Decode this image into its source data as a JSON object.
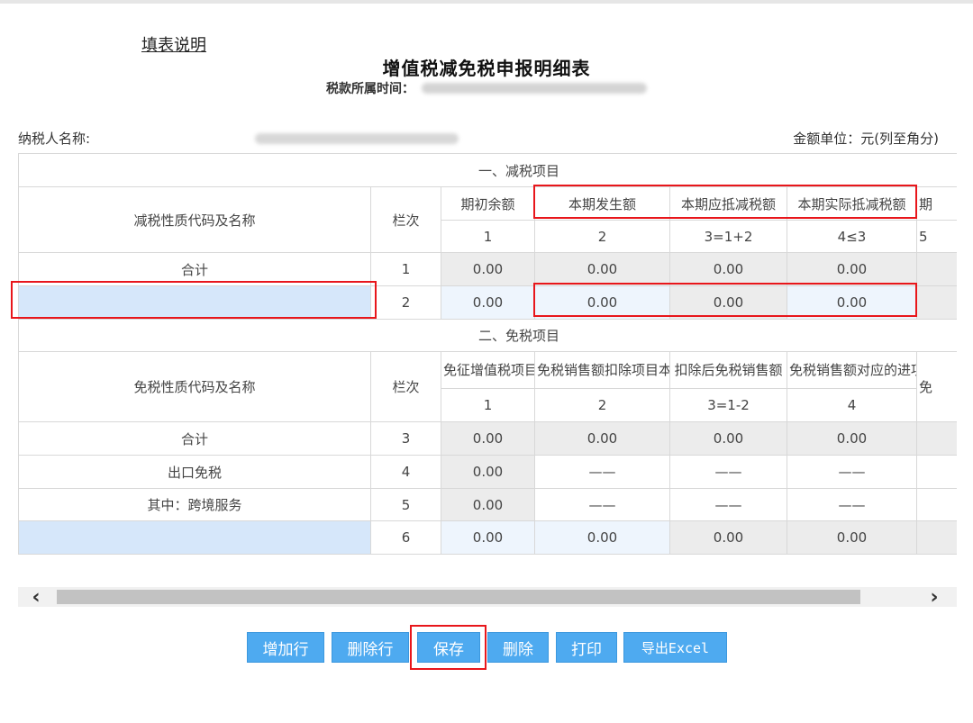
{
  "header": {
    "guide_link": "填表说明",
    "form_title": "增值税减免税申报明细表",
    "period_label": "税款所属时间："
  },
  "info": {
    "taxpayer_label": "纳税人名称:",
    "unit_label": "金额单位：元(列至角分)"
  },
  "reduction": {
    "section_title": "一、减税项目",
    "name_header": "减税性质代码及名称",
    "rownum_header": "栏次",
    "columns": [
      "期初余额",
      "本期发生额",
      "本期应抵减税额",
      "本期实际抵减税额",
      "期"
    ],
    "col_numbers": [
      "1",
      "2",
      "3=1+2",
      "4≤3",
      "5"
    ],
    "rows": [
      {
        "name": "合计",
        "no": "1",
        "values": [
          "0.00",
          "0.00",
          "0.00",
          "0.00"
        ]
      },
      {
        "name": "",
        "no": "2",
        "values": [
          "0.00",
          "0.00",
          "0.00",
          "0.00"
        ]
      }
    ]
  },
  "exemption": {
    "section_title": "二、免税项目",
    "name_header": "免税性质代码及名称",
    "rownum_header": "栏次",
    "columns": [
      "免征增值税项目销售额",
      "免税销售额扣除项目本期实际扣除金额",
      "扣除后免税销售额",
      "免税销售额对应的进项税额",
      "免"
    ],
    "col_numbers": [
      "1",
      "2",
      "3=1-2",
      "4"
    ],
    "rows": [
      {
        "name": "合计",
        "no": "3",
        "values": [
          "0.00",
          "0.00",
          "0.00",
          "0.00"
        ],
        "extra": ""
      },
      {
        "name": "出口免税",
        "no": "4",
        "values": [
          "0.00",
          "——",
          "——",
          "——"
        ],
        "extra": "-"
      },
      {
        "name": "其中：跨境服务",
        "no": "5",
        "values": [
          "0.00",
          "——",
          "——",
          "——"
        ],
        "extra": "-"
      },
      {
        "name": "",
        "no": "6",
        "values": [
          "0.00",
          "0.00",
          "0.00",
          "0.00"
        ],
        "extra": ""
      }
    ]
  },
  "scrollbar": {
    "left_arrow": "‹",
    "right_arrow": "›"
  },
  "buttons": {
    "add_row": "增加行",
    "delete_row": "删除行",
    "save": "保存",
    "delete": "删除",
    "print": "打印",
    "export_excel": "导出Excel"
  },
  "colors": {
    "button_bg": "#4eaaf0",
    "highlight_red": "#e8161b",
    "input_blue": "#d6e7fa",
    "editable_bg": "#eef5fd",
    "readonly_gray": "#ececec"
  }
}
